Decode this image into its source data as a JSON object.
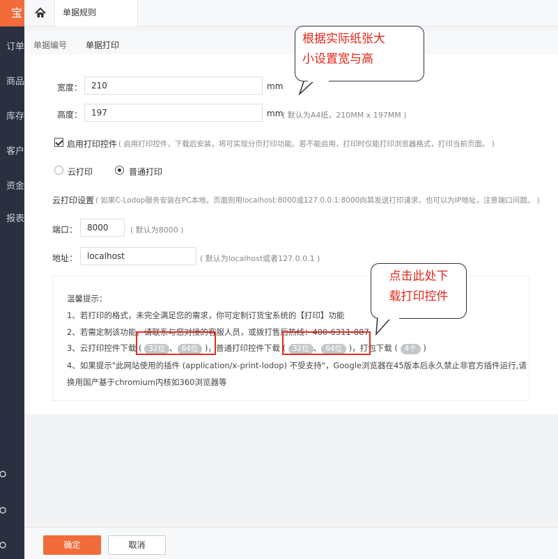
{
  "sidebar": {
    "logo": "宝",
    "items": [
      "订单",
      "商品",
      "库存",
      "客户",
      "资金",
      "报表"
    ]
  },
  "topbar": {
    "tab_label": "单据规则"
  },
  "subtabs": {
    "tab1": "单据编号",
    "tab2": "单据打印"
  },
  "form": {
    "width_label": "宽度：",
    "width_value": "210",
    "width_unit": "mm",
    "height_label": "高度：",
    "height_value": "197",
    "height_unit": "mm",
    "height_hint": "( 默认为A4纸，210MM x 197MM )",
    "enable_label": "启用打印控件",
    "enable_hint": "( 启用打印控件，下载后安装，将可实现分页打印功能。若不能启用，打印时仅能打印浏览器格式，打印当前页面。 )",
    "radio_cloud": "云打印",
    "radio_normal": "普通打印",
    "cloud_settings": "云打印设置",
    "cloud_hint": "( 如果C-Lodop服务安装在PC本地，页面则用localhost:8000或127.0.0.1:8000向其发送打印请求，也可以为IP地址，注意端口问题。 )",
    "port_label": "端口：",
    "port_value": "8000",
    "port_hint": "( 默认为8000 )",
    "addr_label": "地址：",
    "addr_value": "localhost",
    "addr_hint": "( 默认为localhost或者127.0.0.1 )"
  },
  "tips": {
    "title": "温馨提示：",
    "line1": "1、若打印的格式，未完全满足您的需求，你可定制订货宝系统的【打印】功能",
    "line2": "2、若需定制该功能，请联系与您对接的客服人员，或拨打售后热线：400-6311-887",
    "line3_a": "3、云打印控件下载 (",
    "line3_b": ")，普通打印控件下载 (",
    "line3_c": ")，打包下载 (",
    "line3_d": ")",
    "pill_32": "32位",
    "pill_64": "64位",
    "pill_4": "4个",
    "sep": "、",
    "line4": "4、如果提示\"此网站使用的插件 (application/x-print-lodop) 不受支持\"，Google浏览器在45版本后永久禁止非官方插件运行,请",
    "line5": "换用国产基于chromium内核如360浏览器等"
  },
  "callouts": {
    "top_line1": "根据实际纸张大",
    "top_line2": "小设置宽与高",
    "bottom_line1": "点击此处下",
    "bottom_line2": "载打印控件"
  },
  "actions": {
    "confirm": "确定",
    "cancel": "取消"
  },
  "colors": {
    "accent": "#f26b3a",
    "sidebar": "#2b3041",
    "highlight": "#e42a20"
  }
}
